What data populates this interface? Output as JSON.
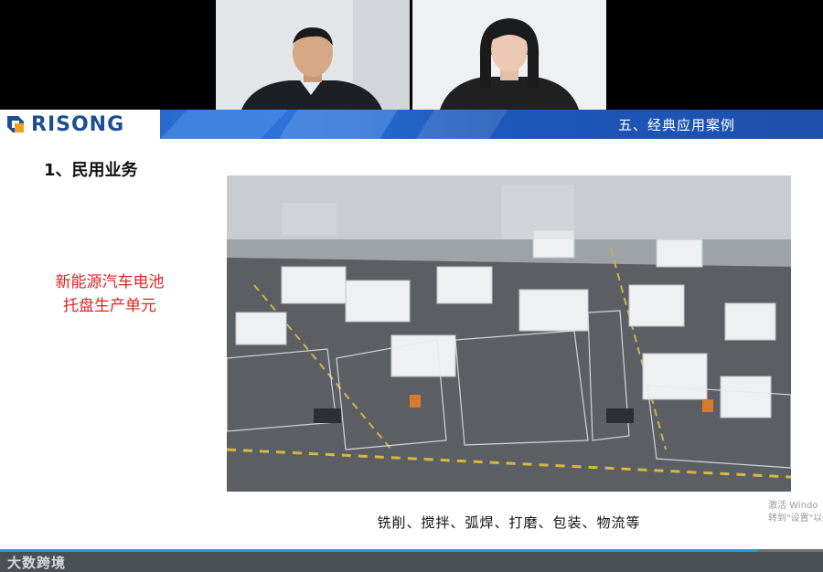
{
  "brand": {
    "name": "RISONG"
  },
  "slide": {
    "section_title": "五、经典应用案例",
    "subheading": "1、民用业务",
    "product_label_line1": "新能源汽车电池",
    "product_label_line2": "托盘生产单元",
    "caption": "铣削、搅拌、弧焊、打磨、包装、物流等"
  },
  "watermark": {
    "line1": "激活 Windo",
    "line2": "转到\"设置\"以激"
  },
  "stream": {
    "logo_text": "大数跨境",
    "progress_percent": 92
  },
  "colors": {
    "banner_blue": "#2f73d8",
    "label_red": "#e32222",
    "progress_blue": "#1aa0e8"
  }
}
